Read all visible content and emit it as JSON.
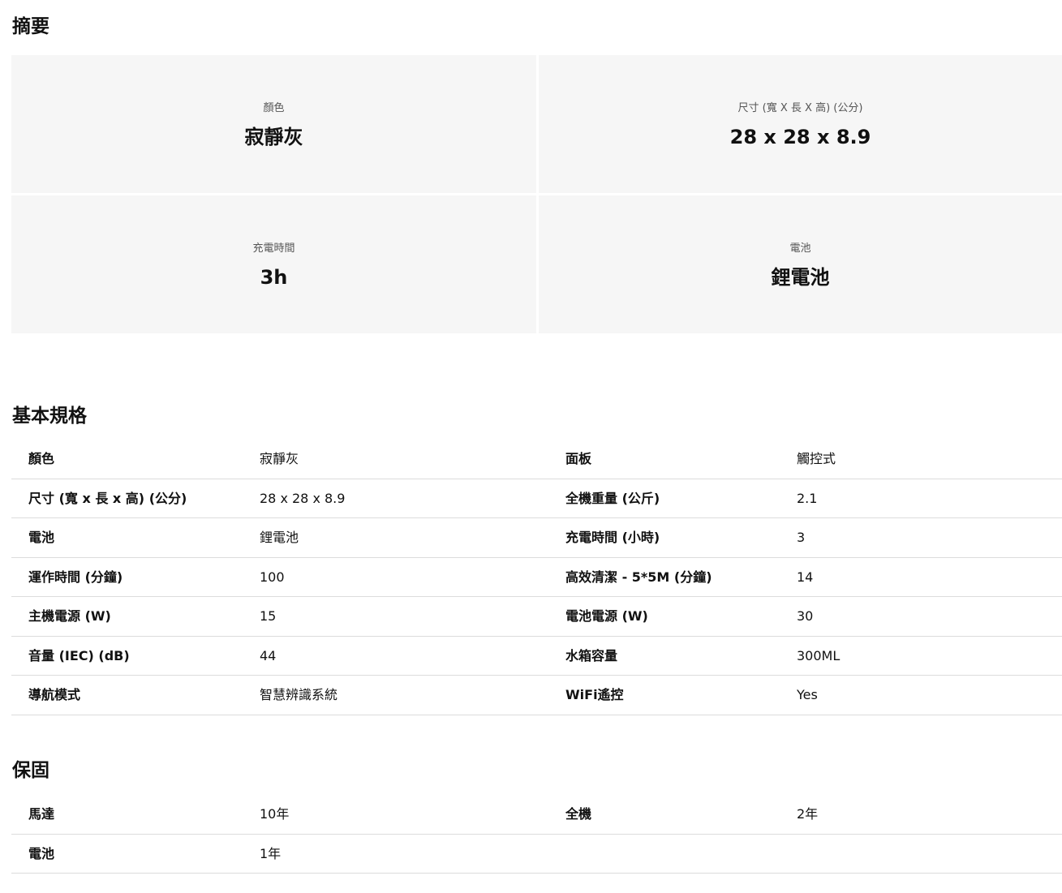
{
  "summary": {
    "title": "摘要",
    "items": [
      {
        "label": "顏色",
        "value": "寂靜灰"
      },
      {
        "label": "尺寸 (寬 X 長 X 高) (公分)",
        "value": "28 x 28 x 8.9"
      },
      {
        "label": "充電時間",
        "value": "3h"
      },
      {
        "label": "電池",
        "value": "鋰電池"
      }
    ]
  },
  "specs": {
    "title": "基本規格",
    "rows": [
      [
        "顏色",
        "寂靜灰",
        "面板",
        "觸控式"
      ],
      [
        "尺寸 (寬 x 長 x 高) (公分)",
        "28 x 28 x 8.9",
        "全機重量 (公斤)",
        "2.1"
      ],
      [
        "電池",
        "鋰電池",
        "充電時間 (小時)",
        "3"
      ],
      [
        "運作時間 (分鐘)",
        "100",
        "高效清潔 - 5*5M (分鐘)",
        "14"
      ],
      [
        "主機電源 (W)",
        "15",
        "電池電源 (W)",
        "30"
      ],
      [
        "音量 (IEC) (dB)",
        "44",
        "水箱容量",
        "300ML"
      ],
      [
        "導航模式",
        "智慧辨識系統",
        "WiFi遙控",
        "Yes"
      ]
    ]
  },
  "warranty": {
    "title": "保固",
    "rows": [
      [
        "馬達",
        "10年",
        "全機",
        "2年"
      ],
      [
        "電池",
        "1年",
        "",
        ""
      ]
    ]
  }
}
